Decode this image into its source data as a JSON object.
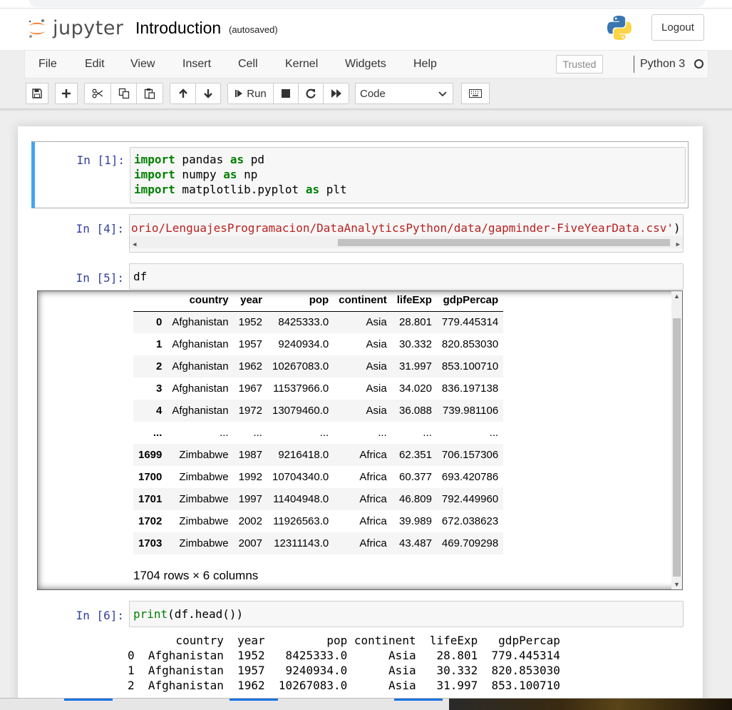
{
  "header": {
    "logo_text": "jupyter",
    "notebook_title": "Introduction",
    "autosave_status": "(autosaved)",
    "logout_label": "Logout"
  },
  "menubar": {
    "items": [
      "File",
      "Edit",
      "View",
      "Insert",
      "Cell",
      "Kernel",
      "Widgets",
      "Help"
    ],
    "trusted_label": "Trusted",
    "kernel_name": "Python 3"
  },
  "toolbar": {
    "run_label": "Run",
    "cell_type": "Code",
    "cell_type_options": [
      "Code"
    ]
  },
  "cells": [
    {
      "prompt": "In [1]:",
      "lines": [
        [
          {
            "t": "import",
            "c": "kw"
          },
          {
            "t": " pandas "
          },
          {
            "t": "as",
            "c": "kw"
          },
          {
            "t": " pd"
          }
        ],
        [
          {
            "t": "import",
            "c": "kw"
          },
          {
            "t": " numpy "
          },
          {
            "t": "as",
            "c": "kw"
          },
          {
            "t": " np"
          }
        ],
        [
          {
            "t": "import",
            "c": "kw"
          },
          {
            "t": " matplotlib.pyplot "
          },
          {
            "t": "as",
            "c": "kw"
          },
          {
            "t": " plt"
          }
        ]
      ]
    },
    {
      "prompt": "In [4]:",
      "lines": [
        [
          {
            "t": "orio/LenguajesProgramacion/DataAnalyticsPython/data/gapminder-FiveYearData.csv'",
            "c": "str"
          },
          {
            "t": ")"
          }
        ]
      ]
    },
    {
      "prompt": "In [5]:",
      "lines": [
        [
          {
            "t": "df"
          }
        ]
      ]
    },
    {
      "prompt": "In [6]:",
      "lines": [
        [
          {
            "t": "print",
            "c": "bi"
          },
          {
            "t": "(df.head())"
          }
        ]
      ]
    }
  ],
  "dataframe": {
    "columns": [
      "",
      "country",
      "year",
      "pop",
      "continent",
      "lifeExp",
      "gdpPercap"
    ],
    "rows": [
      [
        "0",
        "Afghanistan",
        "1952",
        "8425333.0",
        "Asia",
        "28.801",
        "779.445314"
      ],
      [
        "1",
        "Afghanistan",
        "1957",
        "9240934.0",
        "Asia",
        "30.332",
        "820.853030"
      ],
      [
        "2",
        "Afghanistan",
        "1962",
        "10267083.0",
        "Asia",
        "31.997",
        "853.100710"
      ],
      [
        "3",
        "Afghanistan",
        "1967",
        "11537966.0",
        "Asia",
        "34.020",
        "836.197138"
      ],
      [
        "4",
        "Afghanistan",
        "1972",
        "13079460.0",
        "Asia",
        "36.088",
        "739.981106"
      ],
      [
        "...",
        "...",
        "...",
        "...",
        "...",
        "...",
        "..."
      ],
      [
        "1699",
        "Zimbabwe",
        "1987",
        "9216418.0",
        "Africa",
        "62.351",
        "706.157306"
      ],
      [
        "1700",
        "Zimbabwe",
        "1992",
        "10704340.0",
        "Africa",
        "60.377",
        "693.420786"
      ],
      [
        "1701",
        "Zimbabwe",
        "1997",
        "11404948.0",
        "Africa",
        "46.809",
        "792.449960"
      ],
      [
        "1702",
        "Zimbabwe",
        "2002",
        "11926563.0",
        "Africa",
        "39.989",
        "672.038623"
      ],
      [
        "1703",
        "Zimbabwe",
        "2007",
        "12311143.0",
        "Africa",
        "43.487",
        "469.709298"
      ]
    ],
    "dimensions": "1704 rows × 6 columns"
  },
  "print_output": [
    "       country  year         pop continent  lifeExp   gdpPercap",
    "0  Afghanistan  1952   8425333.0      Asia   28.801  779.445314",
    "1  Afghanistan  1957   9240934.0      Asia   30.332  820.853030",
    "2  Afghanistan  1962  10267083.0      Asia   31.997  853.100710"
  ],
  "colors": {
    "selected_cell_border": "#42a5f5",
    "prompt": "#303f9f",
    "keyword": "#008000",
    "string": "#ba2121",
    "jupyter_orange": "#f37726"
  },
  "icons": [
    "save-icon",
    "plus-icon",
    "scissors-icon",
    "copy-icon",
    "paste-icon",
    "arrow-up-icon",
    "arrow-down-icon",
    "step-forward-icon",
    "stop-icon",
    "restart-icon",
    "fast-forward-icon",
    "keyboard-icon",
    "python-logo-icon",
    "kernel-idle-icon"
  ]
}
